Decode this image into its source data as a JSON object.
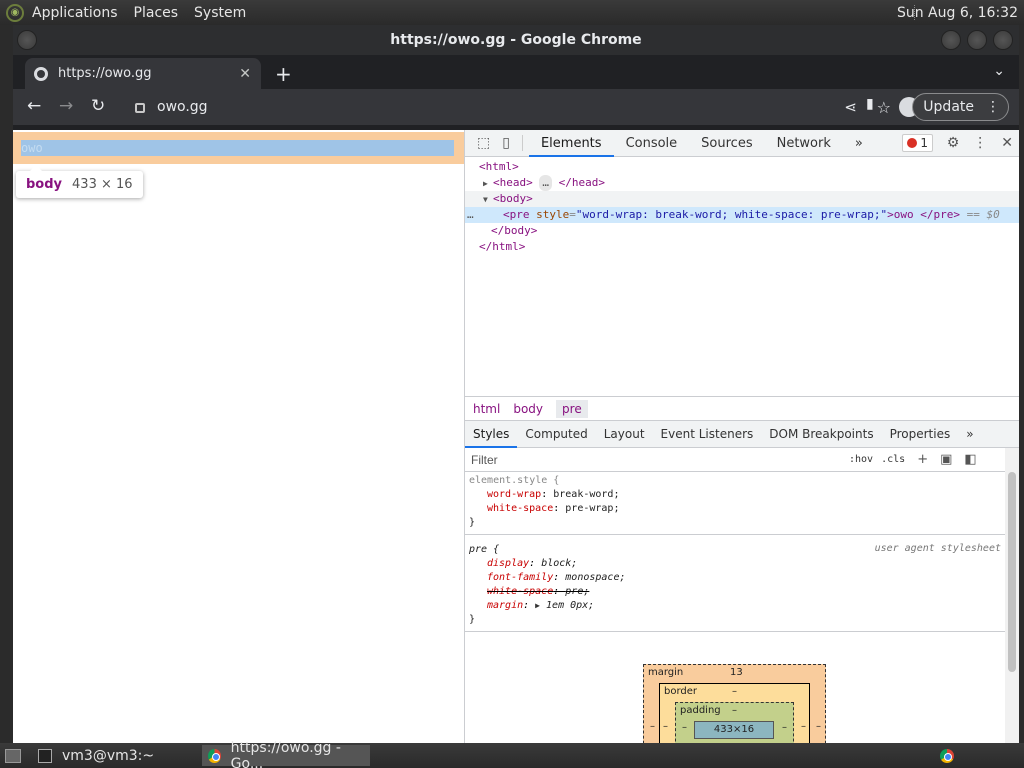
{
  "panel": {
    "menus": [
      "Applications",
      "Places",
      "System"
    ],
    "clock": "Sun Aug  6, 16:32"
  },
  "window": {
    "title": "https://owo.gg - Google Chrome"
  },
  "tab": {
    "title": "https://owo.gg"
  },
  "omnibox": {
    "url": "owo.gg"
  },
  "toolbar": {
    "update_label": "Update"
  },
  "page": {
    "pre_text": "owo",
    "tooltip_tag": "body",
    "tooltip_dims": "433 × 16"
  },
  "devtools": {
    "tabs": [
      "Elements",
      "Console",
      "Sources",
      "Network",
      "»"
    ],
    "error_count": "1",
    "dom": {
      "html_open": "<html>",
      "head": "<head>",
      "head_close": "</head>",
      "head_ellipsis": "…",
      "body_open": "<body>",
      "pre_tag_open": "<pre",
      "pre_attr_name": "style",
      "pre_attr_value": "\"word-wrap: break-word; white-space: pre-wrap;\"",
      "pre_text": ">owo </pre>",
      "pre_suffix": " == $0",
      "body_close": "</body>",
      "html_close": "</html>",
      "ellipsis": "…"
    },
    "breadcrumbs": [
      "html",
      "body",
      "pre"
    ],
    "subtabs": [
      "Styles",
      "Computed",
      "Layout",
      "Event Listeners",
      "DOM Breakpoints",
      "Properties",
      "»"
    ],
    "filter_placeholder": "Filter",
    "filter_hov": ":hov",
    "filter_cls": ".cls",
    "element_style": {
      "selector": "element.style {",
      "decls": [
        {
          "prop": "word-wrap",
          "val": "break-word;"
        },
        {
          "prop": "white-space",
          "val": "pre-wrap;"
        }
      ],
      "close": "}"
    },
    "pre_rule": {
      "selector": "pre {",
      "origin": "user agent stylesheet",
      "decls": [
        {
          "prop": "display",
          "val": "block;"
        },
        {
          "prop": "font-family",
          "val": "monospace;"
        },
        {
          "prop": "white-space",
          "val": "pre;"
        },
        {
          "prop": "margin",
          "val": "1em 0px;"
        }
      ],
      "close": "}"
    },
    "boxmodel": {
      "margin_label": "margin",
      "margin_value": "13",
      "border_label": "border",
      "border_value": "–",
      "padding_label": "padding",
      "padding_value": "–",
      "content": "433×16",
      "dash": "–"
    }
  },
  "taskbar": {
    "terminal": "vm3@vm3:~",
    "chrome": "https://owo.gg - Go..."
  }
}
